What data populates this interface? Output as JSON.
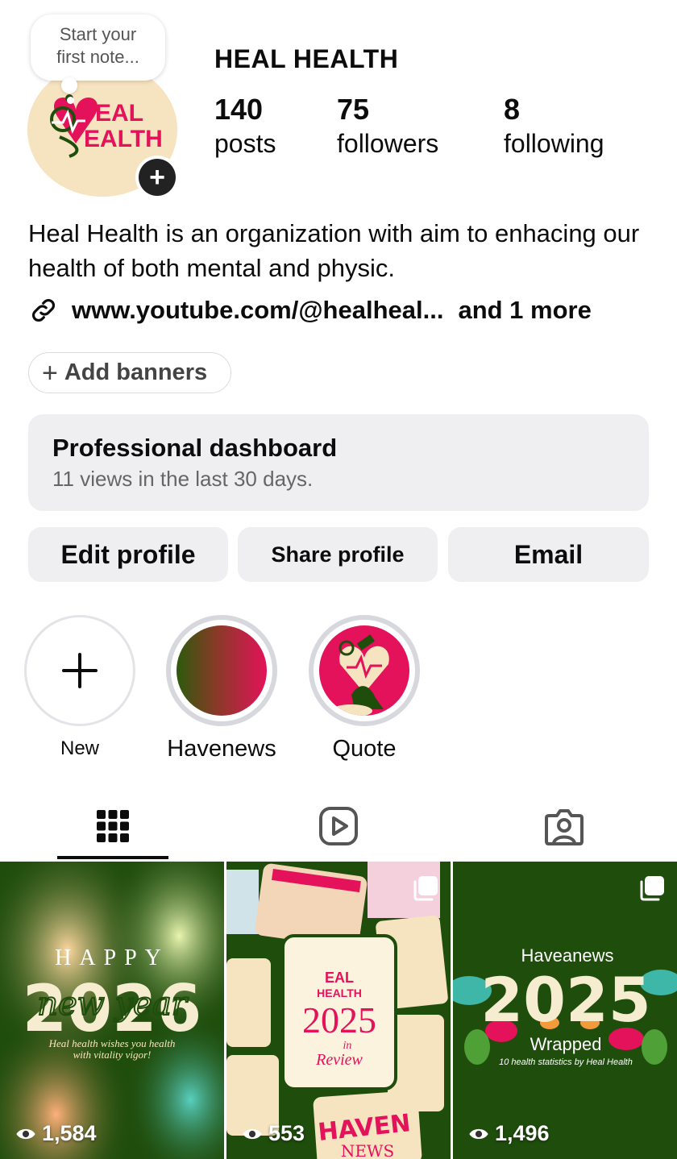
{
  "profile": {
    "note": "Start your\nfirst note...",
    "username": "HEAL HEALTH",
    "avatar_text_1": "EAL",
    "avatar_text_2": "EALTH",
    "stats": [
      {
        "num": "140",
        "label": "posts"
      },
      {
        "num": "75",
        "label": "followers"
      },
      {
        "num": "8",
        "label": "following"
      }
    ],
    "bio": "Heal Health is an organization with aim to enhacing our health of both mental and physic.",
    "link": "www.youtube.com/@healheal...",
    "link_more": "and 1 more"
  },
  "banner": {
    "label": "Add banners"
  },
  "dashboard": {
    "title": "Professional dashboard",
    "subtitle": "11 views in the last 30 days."
  },
  "actions": {
    "edit": "Edit profile",
    "share": "Share profile",
    "email": "Email"
  },
  "highlights": [
    {
      "label": "New"
    },
    {
      "label": "Havenews"
    },
    {
      "label": "Quote"
    }
  ],
  "tabs": {
    "active": "grid",
    "icons": [
      "grid-icon",
      "reels-icon",
      "tagged-icon"
    ]
  },
  "posts": [
    {
      "views": "1,584",
      "line1": "HAPPY",
      "year": "2026",
      "script": "new year",
      "sub1": "Heal health wishes you health",
      "sub2": "with vitality vigor!"
    },
    {
      "views": "553",
      "brand": "EAL",
      "brand2": "HEALTH",
      "year": "2025",
      "script1": "in",
      "script2": "Review",
      "footer": "HAVEN",
      "footer2": "NEWS"
    },
    {
      "views": "1,496",
      "title": "Haveanews",
      "year": "2025",
      "sub": "Wrapped",
      "small": "10 health statistics by Heal Health"
    }
  ],
  "colors": {
    "brand_green": "#1f4d0c",
    "brand_pink": "#e3125a",
    "cream": "#f6e3bf",
    "button_bg": "#efeff2"
  }
}
